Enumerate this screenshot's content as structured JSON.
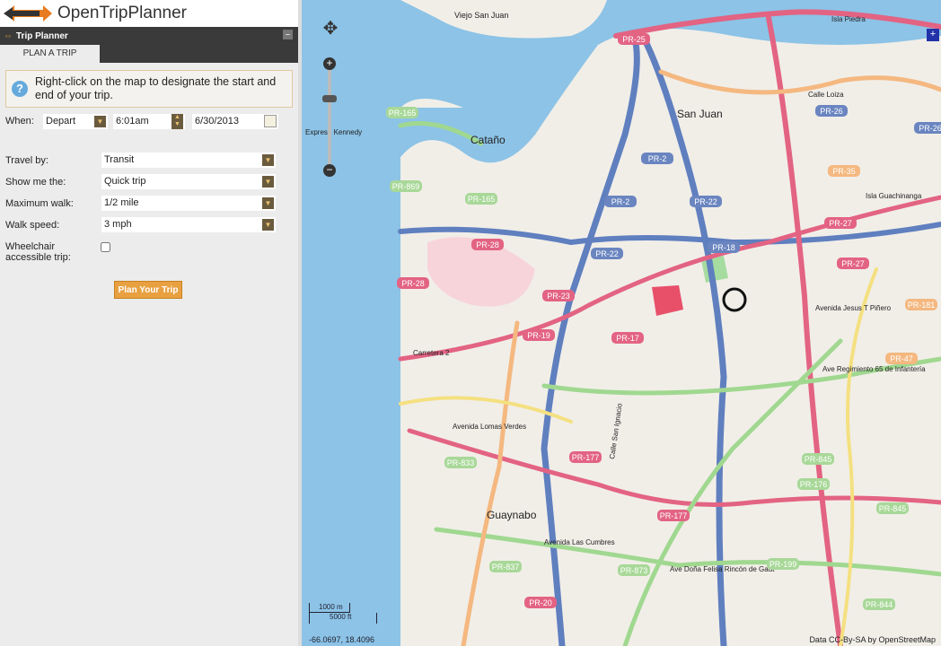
{
  "app": {
    "title": "OpenTripPlanner"
  },
  "panel": {
    "title": "Trip Planner",
    "minimize": "–",
    "tab": "PLAN A TRIP",
    "info": "Right-click on the map to designate the start and end of your trip.",
    "when_label": "When:",
    "depart": "Depart",
    "time": "6:01am",
    "date": "6/30/2013",
    "fields": [
      {
        "label": "Travel by:",
        "value": "Transit"
      },
      {
        "label": "Show me the:",
        "value": "Quick trip"
      },
      {
        "label": "Maximum walk:",
        "value": "1/2 mile"
      },
      {
        "label": "Walk speed:",
        "value": "3 mph"
      }
    ],
    "wheelchair_label": "Wheelchair accessible trip:",
    "wheelchair_checked": false,
    "plan_button": "Plan Your Trip"
  },
  "map": {
    "places": [
      "Viejo San Juan",
      "San Juan",
      "Cataño",
      "Guaynabo",
      "Isla Piedra",
      "Isla Guachinanga",
      "Calle Loiza",
      "Avenida Jesus T Piñero",
      "Avenida Lomas Verdes",
      "Avenida Las Cumbres",
      "Ave Doña Felisa Rincón de Gaut",
      "Carretera 2",
      "Calle San Ignacio",
      "Ave Regimiento 65 de Infantería",
      "Expreso Kennedy"
    ],
    "shields": [
      "PR-25",
      "PR-26",
      "PR-26",
      "PR-165",
      "PR-165",
      "PR-2",
      "PR-2",
      "PR-22",
      "PR-22",
      "PR-18",
      "PR-28",
      "PR-28",
      "PR-23",
      "PR-19",
      "PR-17",
      "PR-27",
      "PR-27",
      "PR-35",
      "PR-181",
      "PR-47",
      "PR-177",
      "PR-177",
      "PR-176",
      "PR-845",
      "PR-845",
      "PR-833",
      "PR-837",
      "PR-873",
      "PR-199",
      "PR-844",
      "PR-20",
      "PR-869"
    ],
    "scale_m": "1000 m",
    "scale_ft": "5000 ft",
    "coords": "-66.0697, 18.4096",
    "attribution": "Data CC-By-SA by OpenStreetMap"
  }
}
